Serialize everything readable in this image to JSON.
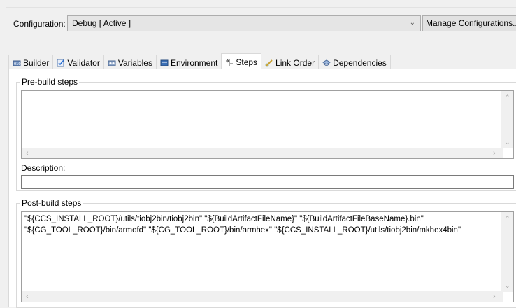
{
  "configuration": {
    "label": "Configuration:",
    "selected": "Debug  [ Active ]",
    "manage_button": "Manage Configurations..."
  },
  "tabs": [
    {
      "label": "Builder",
      "icon": "builder-icon"
    },
    {
      "label": "Validator",
      "icon": "validator-icon"
    },
    {
      "label": "Variables",
      "icon": "variables-icon"
    },
    {
      "label": "Environment",
      "icon": "environment-icon"
    },
    {
      "label": "Steps",
      "icon": "steps-icon",
      "active": true
    },
    {
      "label": "Link Order",
      "icon": "link-order-icon"
    },
    {
      "label": "Dependencies",
      "icon": "dependencies-icon"
    }
  ],
  "pre_build": {
    "title": "Pre-build steps",
    "value": "",
    "description_label": "Description:",
    "description_value": ""
  },
  "post_build": {
    "title": "Post-build steps",
    "line1": "\"${CCS_INSTALL_ROOT}/utils/tiobj2bin/tiobj2bin\" \"${BuildArtifactFileName}\" \"${BuildArtifactFileBaseName}.bin\"",
    "line2": "\"${CG_TOOL_ROOT}/bin/armofd\" \"${CG_TOOL_ROOT}/bin/armhex\" \"${CCS_INSTALL_ROOT}/utils/tiobj2bin/mkhex4bin\""
  }
}
